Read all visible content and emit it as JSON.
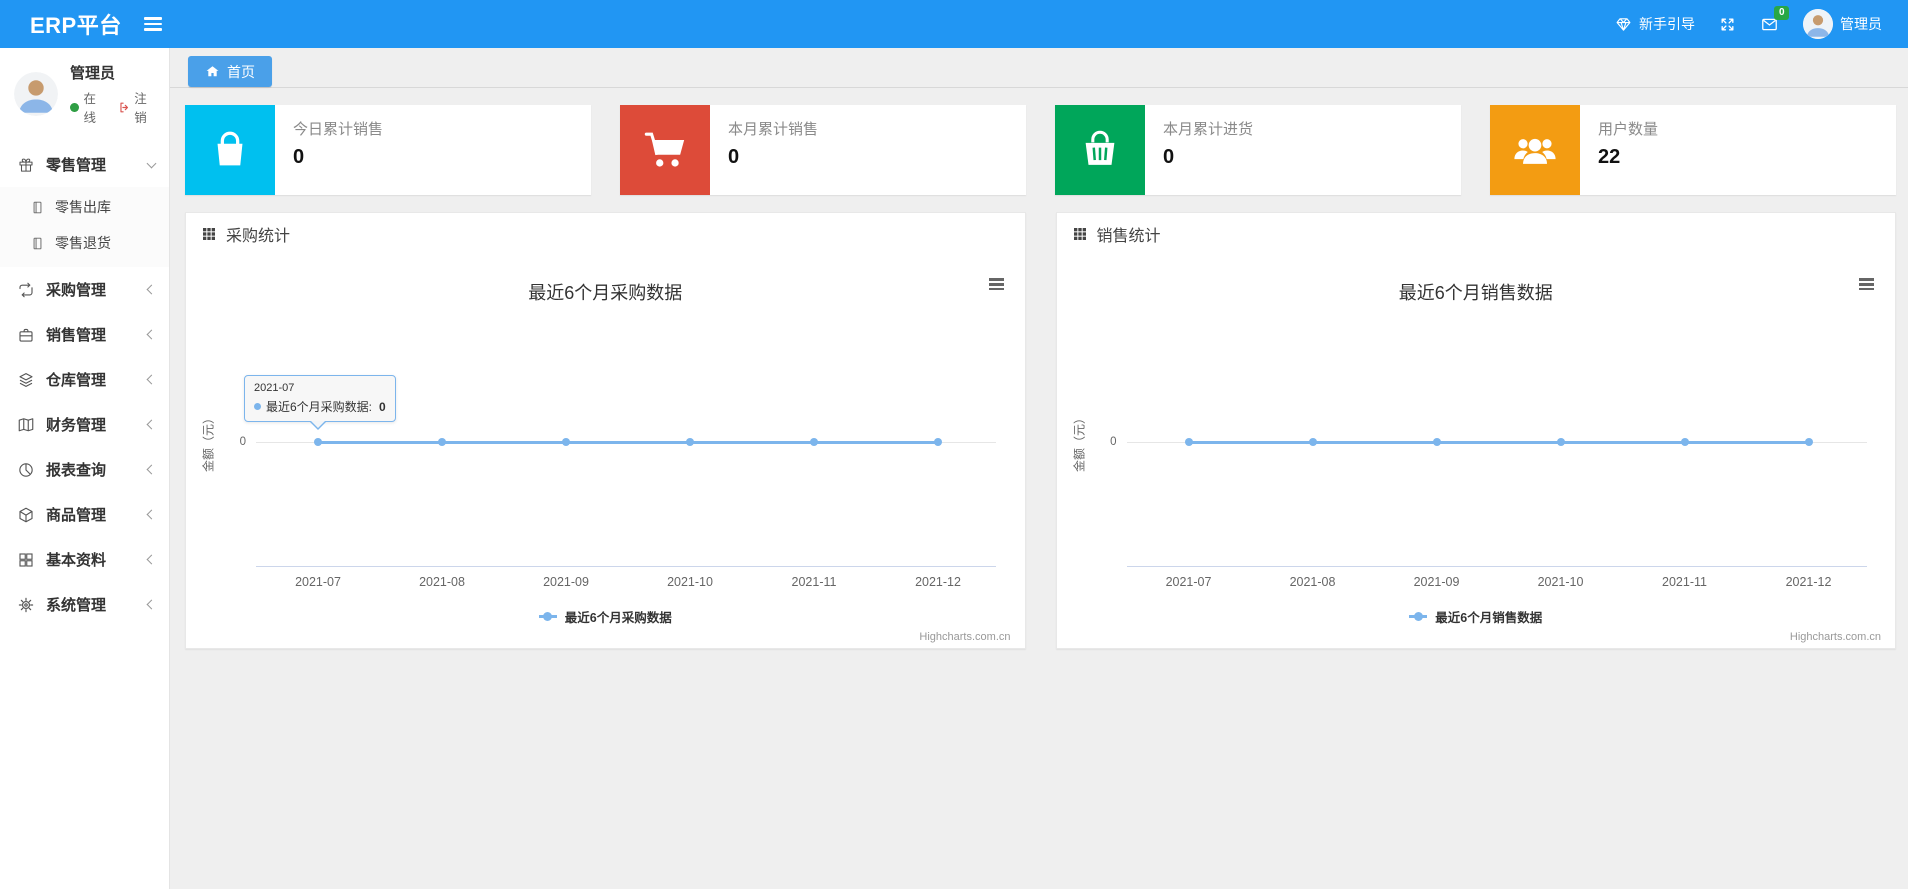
{
  "header": {
    "brand": "ERP平台",
    "guide_label": "新手引导",
    "mail_badge": "0",
    "user_name": "管理员"
  },
  "sidebar": {
    "user": {
      "name": "管理员",
      "status_label": "在线",
      "logout_label": "注销"
    },
    "items": [
      {
        "label": "零售管理",
        "icon": "gift-icon",
        "state": "expanded",
        "children": [
          {
            "label": "零售出库"
          },
          {
            "label": "零售退货"
          }
        ]
      },
      {
        "label": "采购管理",
        "icon": "procurement-icon",
        "state": "collapsed"
      },
      {
        "label": "销售管理",
        "icon": "briefcase-icon",
        "state": "collapsed"
      },
      {
        "label": "仓库管理",
        "icon": "layers-icon",
        "state": "collapsed"
      },
      {
        "label": "财务管理",
        "icon": "finance-book-icon",
        "state": "collapsed"
      },
      {
        "label": "报表查询",
        "icon": "pie-chart-icon",
        "state": "collapsed"
      },
      {
        "label": "商品管理",
        "icon": "box-icon",
        "state": "collapsed"
      },
      {
        "label": "基本资料",
        "icon": "grid-icon",
        "state": "collapsed"
      },
      {
        "label": "系统管理",
        "icon": "gear-icon",
        "state": "collapsed"
      }
    ]
  },
  "tabs": [
    {
      "label": "首页",
      "active": true
    }
  ],
  "cards": [
    {
      "label": "今日累计销售",
      "value": "0",
      "color": "#00c0ef",
      "icon": "shopping-bag-icon"
    },
    {
      "label": "本月累计销售",
      "value": "0",
      "color": "#dd4b39",
      "icon": "shopping-cart-icon"
    },
    {
      "label": "本月累计进货",
      "value": "0",
      "color": "#00a65a",
      "icon": "shopping-basket-icon"
    },
    {
      "label": "用户数量",
      "value": "22",
      "color": "#f39c12",
      "icon": "users-icon"
    }
  ],
  "chart_data": [
    {
      "type": "line",
      "panel_title": "采购统计",
      "title": "最近6个月采购数据",
      "categories": [
        "2021-07",
        "2021-08",
        "2021-09",
        "2021-10",
        "2021-11",
        "2021-12"
      ],
      "series": [
        {
          "name": "最近6个月采购数据",
          "values": [
            0,
            0,
            0,
            0,
            0,
            0
          ],
          "color": "#7cb5ec"
        }
      ],
      "ylabel": "金额（元）",
      "yticks": [
        "0"
      ],
      "ylim": [
        0,
        1
      ],
      "grid": "zero-line-only",
      "legend_position": "bottom",
      "credit": "Highcharts.com.cn",
      "tooltip": {
        "category": "2021-07",
        "series_label": "最近6个月采购数据:",
        "value": "0"
      }
    },
    {
      "type": "line",
      "panel_title": "销售统计",
      "title": "最近6个月销售数据",
      "categories": [
        "2021-07",
        "2021-08",
        "2021-09",
        "2021-10",
        "2021-11",
        "2021-12"
      ],
      "series": [
        {
          "name": "最近6个月销售数据",
          "values": [
            0,
            0,
            0,
            0,
            0,
            0
          ],
          "color": "#7cb5ec"
        }
      ],
      "ylabel": "金额（元）",
      "yticks": [
        "0"
      ],
      "ylim": [
        0,
        1
      ],
      "grid": "zero-line-only",
      "legend_position": "bottom",
      "credit": "Highcharts.com.cn",
      "tooltip": null
    }
  ]
}
